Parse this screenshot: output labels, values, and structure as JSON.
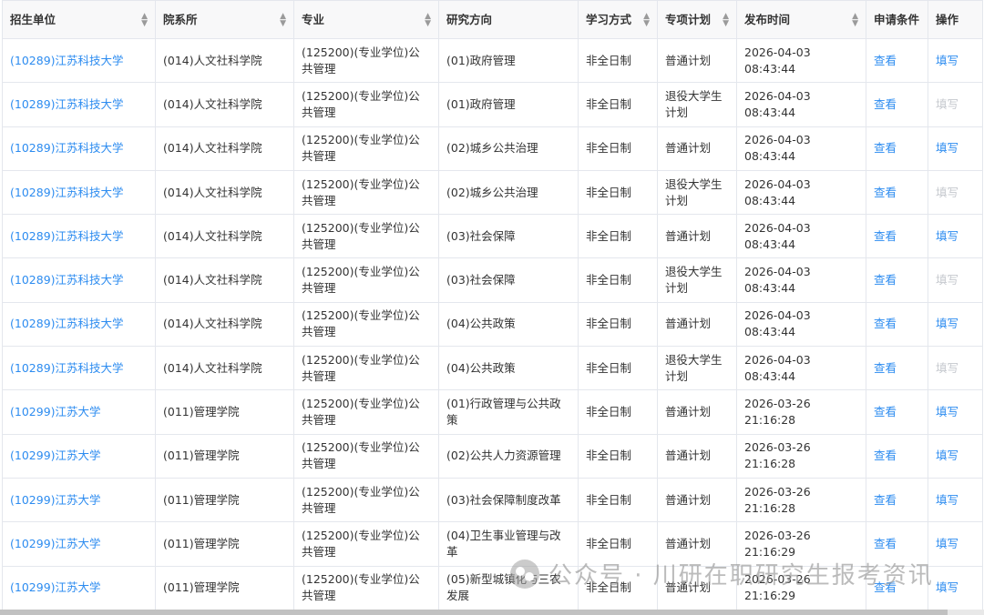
{
  "columns": [
    {
      "label": "招生单位",
      "sortable": true
    },
    {
      "label": "院系所",
      "sortable": true
    },
    {
      "label": "专业",
      "sortable": true
    },
    {
      "label": "研究方向",
      "sortable": false
    },
    {
      "label": "学习方式",
      "sortable": true
    },
    {
      "label": "专项计划",
      "sortable": true
    },
    {
      "label": "发布时间",
      "sortable": true
    },
    {
      "label": "申请条件",
      "sortable": false
    },
    {
      "label": "操作",
      "sortable": false
    }
  ],
  "rows": [
    {
      "unit": "(10289)江苏科技大学",
      "dept": "(014)人文社科学院",
      "major": "(125200)(专业学位)公共管理",
      "direction": "(01)政府管理",
      "mode": "非全日制",
      "plan": "普通计划",
      "time": "2026-04-03 08:43:44",
      "cond": "查看",
      "action": "填写",
      "action_disabled": false
    },
    {
      "unit": "(10289)江苏科技大学",
      "dept": "(014)人文社科学院",
      "major": "(125200)(专业学位)公共管理",
      "direction": "(01)政府管理",
      "mode": "非全日制",
      "plan": "退役大学生计划",
      "time": "2026-04-03 08:43:44",
      "cond": "查看",
      "action": "填写",
      "action_disabled": true
    },
    {
      "unit": "(10289)江苏科技大学",
      "dept": "(014)人文社科学院",
      "major": "(125200)(专业学位)公共管理",
      "direction": "(02)城乡公共治理",
      "mode": "非全日制",
      "plan": "普通计划",
      "time": "2026-04-03 08:43:44",
      "cond": "查看",
      "action": "填写",
      "action_disabled": false
    },
    {
      "unit": "(10289)江苏科技大学",
      "dept": "(014)人文社科学院",
      "major": "(125200)(专业学位)公共管理",
      "direction": "(02)城乡公共治理",
      "mode": "非全日制",
      "plan": "退役大学生计划",
      "time": "2026-04-03 08:43:44",
      "cond": "查看",
      "action": "填写",
      "action_disabled": true
    },
    {
      "unit": "(10289)江苏科技大学",
      "dept": "(014)人文社科学院",
      "major": "(125200)(专业学位)公共管理",
      "direction": "(03)社会保障",
      "mode": "非全日制",
      "plan": "普通计划",
      "time": "2026-04-03 08:43:44",
      "cond": "查看",
      "action": "填写",
      "action_disabled": false
    },
    {
      "unit": "(10289)江苏科技大学",
      "dept": "(014)人文社科学院",
      "major": "(125200)(专业学位)公共管理",
      "direction": "(03)社会保障",
      "mode": "非全日制",
      "plan": "退役大学生计划",
      "time": "2026-04-03 08:43:44",
      "cond": "查看",
      "action": "填写",
      "action_disabled": true
    },
    {
      "unit": "(10289)江苏科技大学",
      "dept": "(014)人文社科学院",
      "major": "(125200)(专业学位)公共管理",
      "direction": "(04)公共政策",
      "mode": "非全日制",
      "plan": "普通计划",
      "time": "2026-04-03 08:43:44",
      "cond": "查看",
      "action": "填写",
      "action_disabled": false
    },
    {
      "unit": "(10289)江苏科技大学",
      "dept": "(014)人文社科学院",
      "major": "(125200)(专业学位)公共管理",
      "direction": "(04)公共政策",
      "mode": "非全日制",
      "plan": "退役大学生计划",
      "time": "2026-04-03 08:43:44",
      "cond": "查看",
      "action": "填写",
      "action_disabled": true
    },
    {
      "unit": "(10299)江苏大学",
      "dept": "(011)管理学院",
      "major": "(125200)(专业学位)公共管理",
      "direction": "(01)行政管理与公共政策",
      "mode": "非全日制",
      "plan": "普通计划",
      "time": "2026-03-26 21:16:28",
      "cond": "查看",
      "action": "填写",
      "action_disabled": false
    },
    {
      "unit": "(10299)江苏大学",
      "dept": "(011)管理学院",
      "major": "(125200)(专业学位)公共管理",
      "direction": "(02)公共人力资源管理",
      "mode": "非全日制",
      "plan": "普通计划",
      "time": "2026-03-26 21:16:28",
      "cond": "查看",
      "action": "填写",
      "action_disabled": false
    },
    {
      "unit": "(10299)江苏大学",
      "dept": "(011)管理学院",
      "major": "(125200)(专业学位)公共管理",
      "direction": "(03)社会保障制度改革",
      "mode": "非全日制",
      "plan": "普通计划",
      "time": "2026-03-26 21:16:28",
      "cond": "查看",
      "action": "填写",
      "action_disabled": false
    },
    {
      "unit": "(10299)江苏大学",
      "dept": "(011)管理学院",
      "major": "(125200)(专业学位)公共管理",
      "direction": "(04)卫生事业管理与改革",
      "mode": "非全日制",
      "plan": "普通计划",
      "time": "2026-03-26 21:16:29",
      "cond": "查看",
      "action": "填写",
      "action_disabled": false
    },
    {
      "unit": "(10299)江苏大学",
      "dept": "(011)管理学院",
      "major": "(125200)(专业学位)公共管理",
      "direction": "(05)新型城镇化与三农发展",
      "mode": "非全日制",
      "plan": "普通计划",
      "time": "2026-03-26 21:16:29",
      "cond": "查看",
      "action": "填写",
      "action_disabled": false
    }
  ],
  "watermark": "公众号 · 川研在职研究生报考资讯",
  "colors": {
    "link": "#2d8cf0",
    "disabled": "#c5c8ce",
    "header_bg": "#f8f8f9",
    "border": "#e4e7ed"
  }
}
